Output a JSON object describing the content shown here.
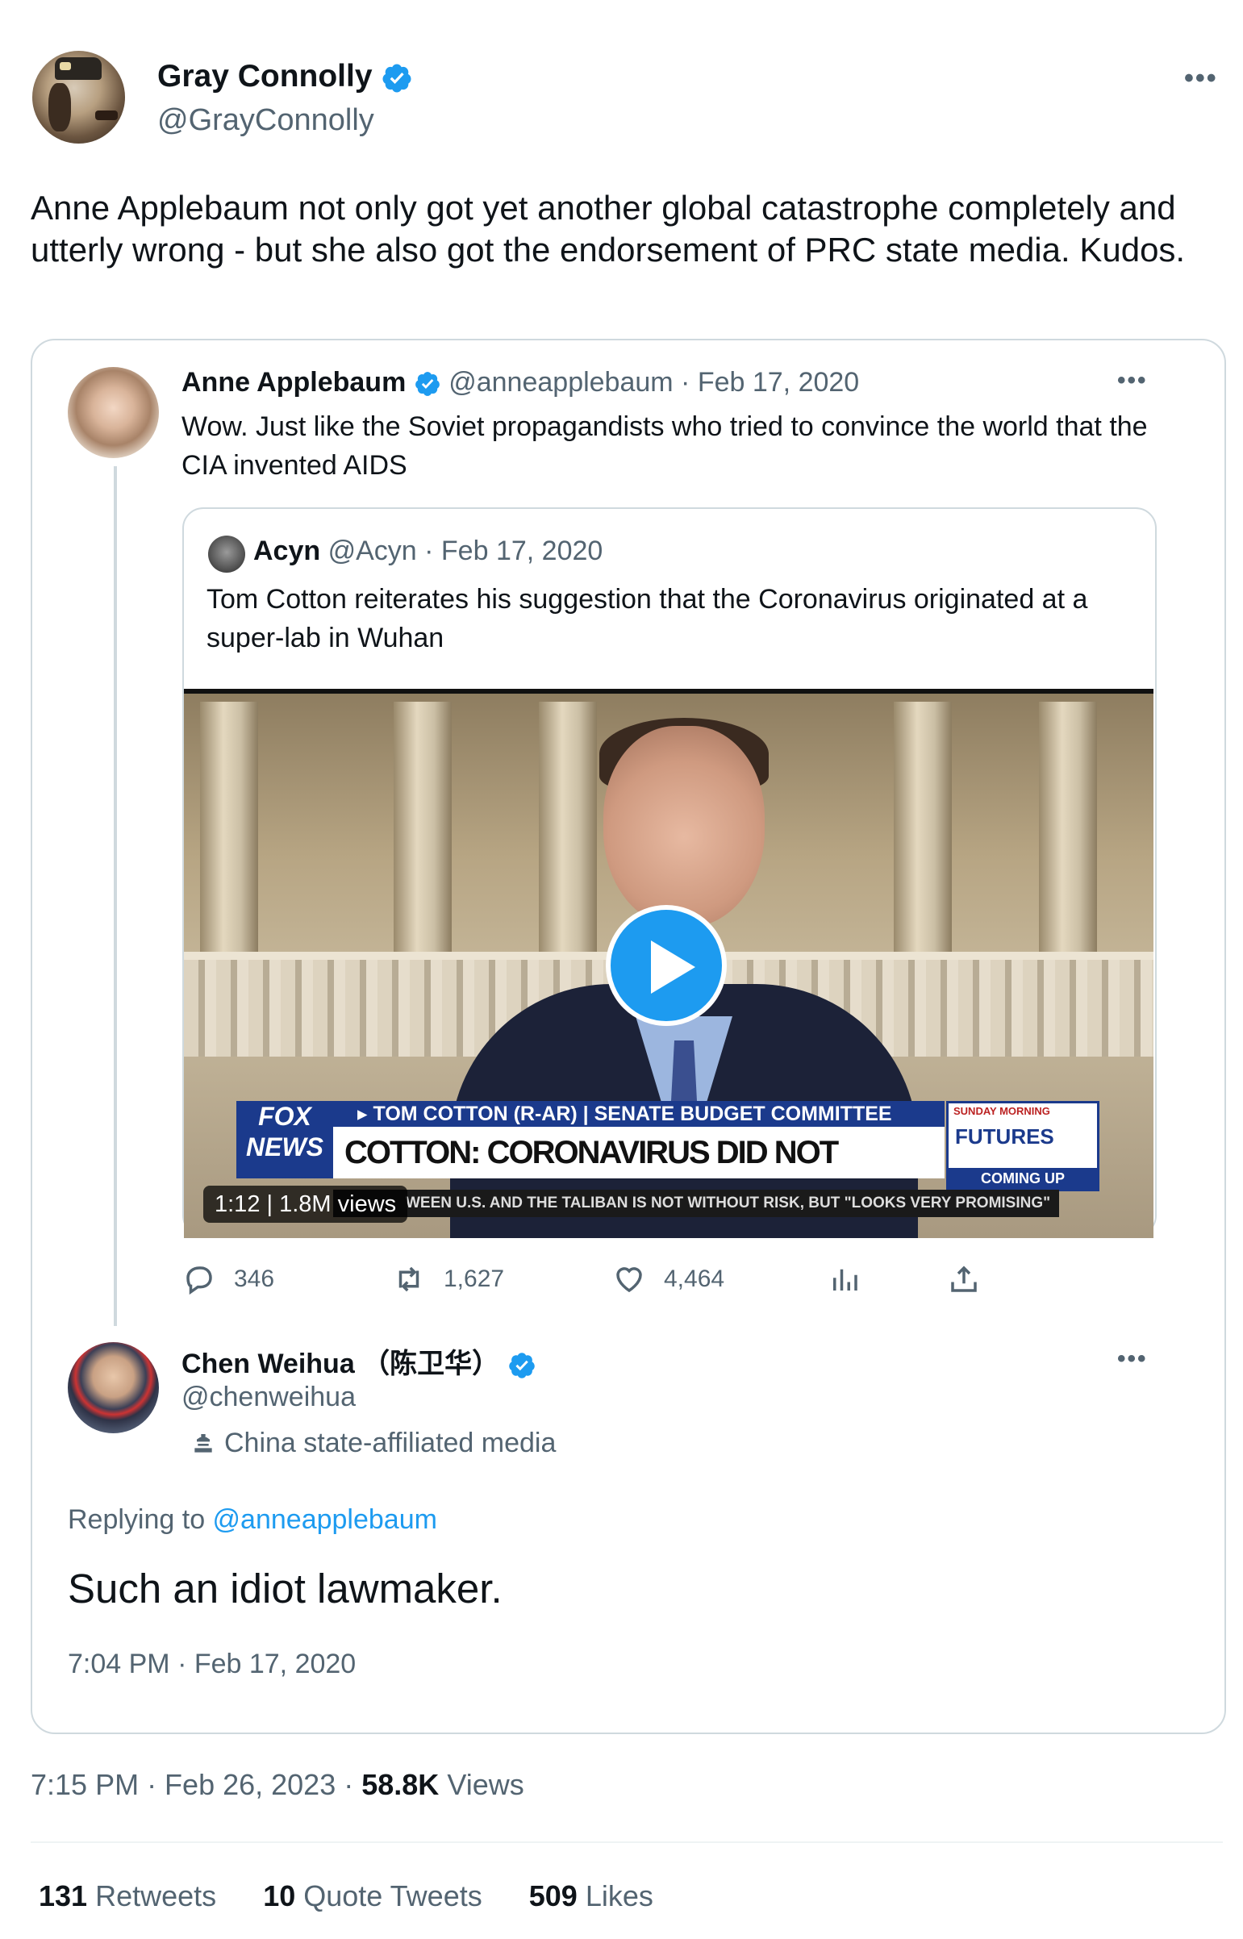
{
  "main_tweet": {
    "author_name": "Gray Connolly",
    "author_handle": "@GrayConnolly",
    "text": "Anne Applebaum not only got yet another global catastrophe completely and utterly wrong - but she also got the endorsement of PRC state media. Kudos.",
    "timestamp": "7:15 PM · Feb 26, 2023 · ",
    "views_count": "58.8K",
    "views_label": "Views",
    "retweets_count": "131",
    "retweets_label": "Retweets",
    "quotes_count": "10",
    "quotes_label": "Quote Tweets",
    "likes_count": "509",
    "likes_label": "Likes"
  },
  "quoted_thread": {
    "applebaum": {
      "name": "Anne Applebaum",
      "meta": "@anneapplebaum · Feb 17, 2020",
      "text": "Wow. Just like the Soviet propagandists who tried to convince the world that the CIA invented AIDS",
      "stats": {
        "replies": "346",
        "retweets": "1,627",
        "likes": "4,464"
      }
    },
    "acyn": {
      "name": "Acyn",
      "meta": "@Acyn · Feb 17, 2020",
      "text": "Tom Cotton reiterates his suggestion that the Coronavirus originated at a super-lab in Wuhan",
      "video": {
        "duration": "1:12",
        "views": "1.8M views",
        "chyron_top": "▸ TOM COTTON (R-AR) | SENATE BUDGET COMMITTEE",
        "chyron_main": "COTTON: CORONAVIRUS DID NOT ORIGINATE IN WUHAN MKT",
        "ticker": "WEEN U.S. AND THE TALIBAN IS NOT WITHOUT RISK, BUT \"LOOKS VERY PROMISING\"",
        "logo_line1": "FOX",
        "logo_line2": "NEWS",
        "promo_top": "SUNDAY MORNING",
        "promo_title": "FUTURES",
        "promo_bottom": "COMING UP"
      }
    },
    "chen": {
      "name": "Chen Weihua （陈卫华）",
      "handle": "@chenweihua",
      "affiliation": "China state-affiliated media",
      "replying_prefix": "Replying to ",
      "replying_to": "@anneapplebaum",
      "text": "Such an idiot lawmaker.",
      "time": "7:04 PM · Feb 17, 2020"
    }
  },
  "colors": {
    "accent": "#1d9bf0",
    "muted": "#536471",
    "text": "#0f1419",
    "border": "#cfd9de"
  }
}
